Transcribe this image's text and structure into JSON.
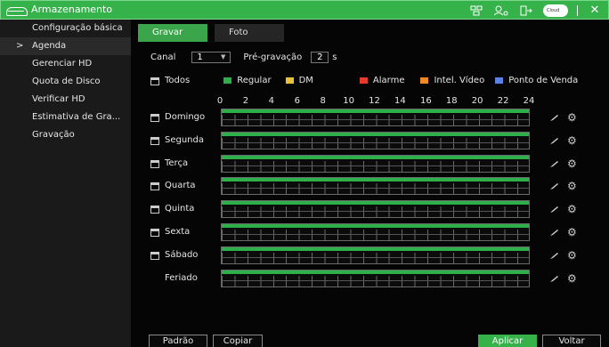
{
  "app": {
    "title": "Armazenamento"
  },
  "sidebar": {
    "items": [
      {
        "label": "Configuração básica",
        "active": false
      },
      {
        "label": "Agenda",
        "active": true
      },
      {
        "label": "Gerenciar HD",
        "active": false
      },
      {
        "label": "Quota de Disco",
        "active": false
      },
      {
        "label": "Verificar HD",
        "active": false
      },
      {
        "label": "Estimativa de Gra...",
        "active": false
      },
      {
        "label": "Gravação",
        "active": false
      }
    ],
    "arrow": ">"
  },
  "tabs": [
    {
      "label": "Gravar"
    },
    {
      "label": "Foto"
    }
  ],
  "channel": {
    "label": "Canal",
    "value": "1",
    "chevron": "▼"
  },
  "prerecord": {
    "label": "Pré-gravação",
    "value": "2",
    "unit": "s"
  },
  "legend": {
    "all_label": "Todos",
    "items": [
      {
        "label": "Regular",
        "color": "#2db049"
      },
      {
        "label": "DM",
        "color": "#e8c33a"
      },
      {
        "label": "Alarme",
        "color": "#e63a2e"
      },
      {
        "label": "Intel. Vídeo",
        "color": "#f08a24"
      },
      {
        "label": "Ponto de Venda",
        "color": "#5b83e6"
      }
    ]
  },
  "scale": [
    "0",
    "2",
    "4",
    "6",
    "8",
    "10",
    "12",
    "14",
    "16",
    "18",
    "20",
    "22",
    "24"
  ],
  "days": [
    {
      "label": "Domingo",
      "has_icon": true,
      "regular_coverage": 1.0
    },
    {
      "label": "Segunda",
      "has_icon": true,
      "regular_coverage": 1.0
    },
    {
      "label": "Terça",
      "has_icon": true,
      "regular_coverage": 1.0
    },
    {
      "label": "Quarta",
      "has_icon": true,
      "regular_coverage": 1.0
    },
    {
      "label": "Quinta",
      "has_icon": true,
      "regular_coverage": 1.0
    },
    {
      "label": "Sexta",
      "has_icon": true,
      "regular_coverage": 1.0
    },
    {
      "label": "Sábado",
      "has_icon": true,
      "regular_coverage": 1.0
    },
    {
      "label": "Feriado",
      "has_icon": false,
      "regular_coverage": 1.0
    }
  ],
  "buttons": {
    "default": "Padrão",
    "copy": "Copiar",
    "apply": "Aplicar",
    "back": "Voltar"
  },
  "colors": {
    "accent": "#36b24a"
  }
}
